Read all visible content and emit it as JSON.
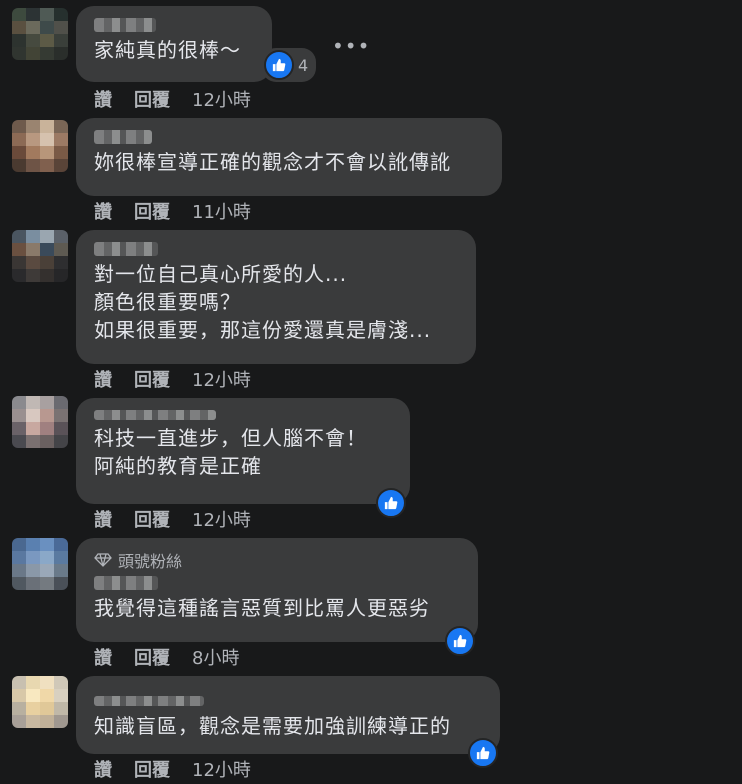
{
  "comments": [
    {
      "text": "家純真的很棒～",
      "like_count": "4",
      "actions": {
        "like": "讚",
        "reply": "回覆",
        "time": "12小時"
      }
    },
    {
      "text": "妳很棒宣導正確的觀念才不會以訛傳訛",
      "actions": {
        "like": "讚",
        "reply": "回覆",
        "time": "11小時"
      }
    },
    {
      "text": "對一位自己真心所愛的人...\n顏色很重要嗎？\n如果很重要，那這份愛還真是膚淺...",
      "actions": {
        "like": "讚",
        "reply": "回覆",
        "time": "12小時"
      }
    },
    {
      "text": "科技一直進步，但人腦不會！\n阿純的教育是正確",
      "actions": {
        "like": "讚",
        "reply": "回覆",
        "time": "12小時"
      }
    },
    {
      "badge": "頭號粉絲",
      "text": "我覺得這種謠言惡質到比罵人更惡劣",
      "actions": {
        "like": "讚",
        "reply": "回覆",
        "time": "8小時"
      }
    },
    {
      "text": "知識盲區，觀念是需要加強訓練導正的",
      "actions": {
        "like": "讚",
        "reply": "回覆",
        "time": "12小時"
      }
    }
  ],
  "colors": {
    "background": "#18191a",
    "bubble": "#3a3b3c",
    "like_blue": "#1877f2",
    "meta": "#b0b3b8"
  },
  "icons": {
    "like": "thumbs-up-icon",
    "more": "more-horizontal-icon",
    "badge": "diamond-icon"
  }
}
